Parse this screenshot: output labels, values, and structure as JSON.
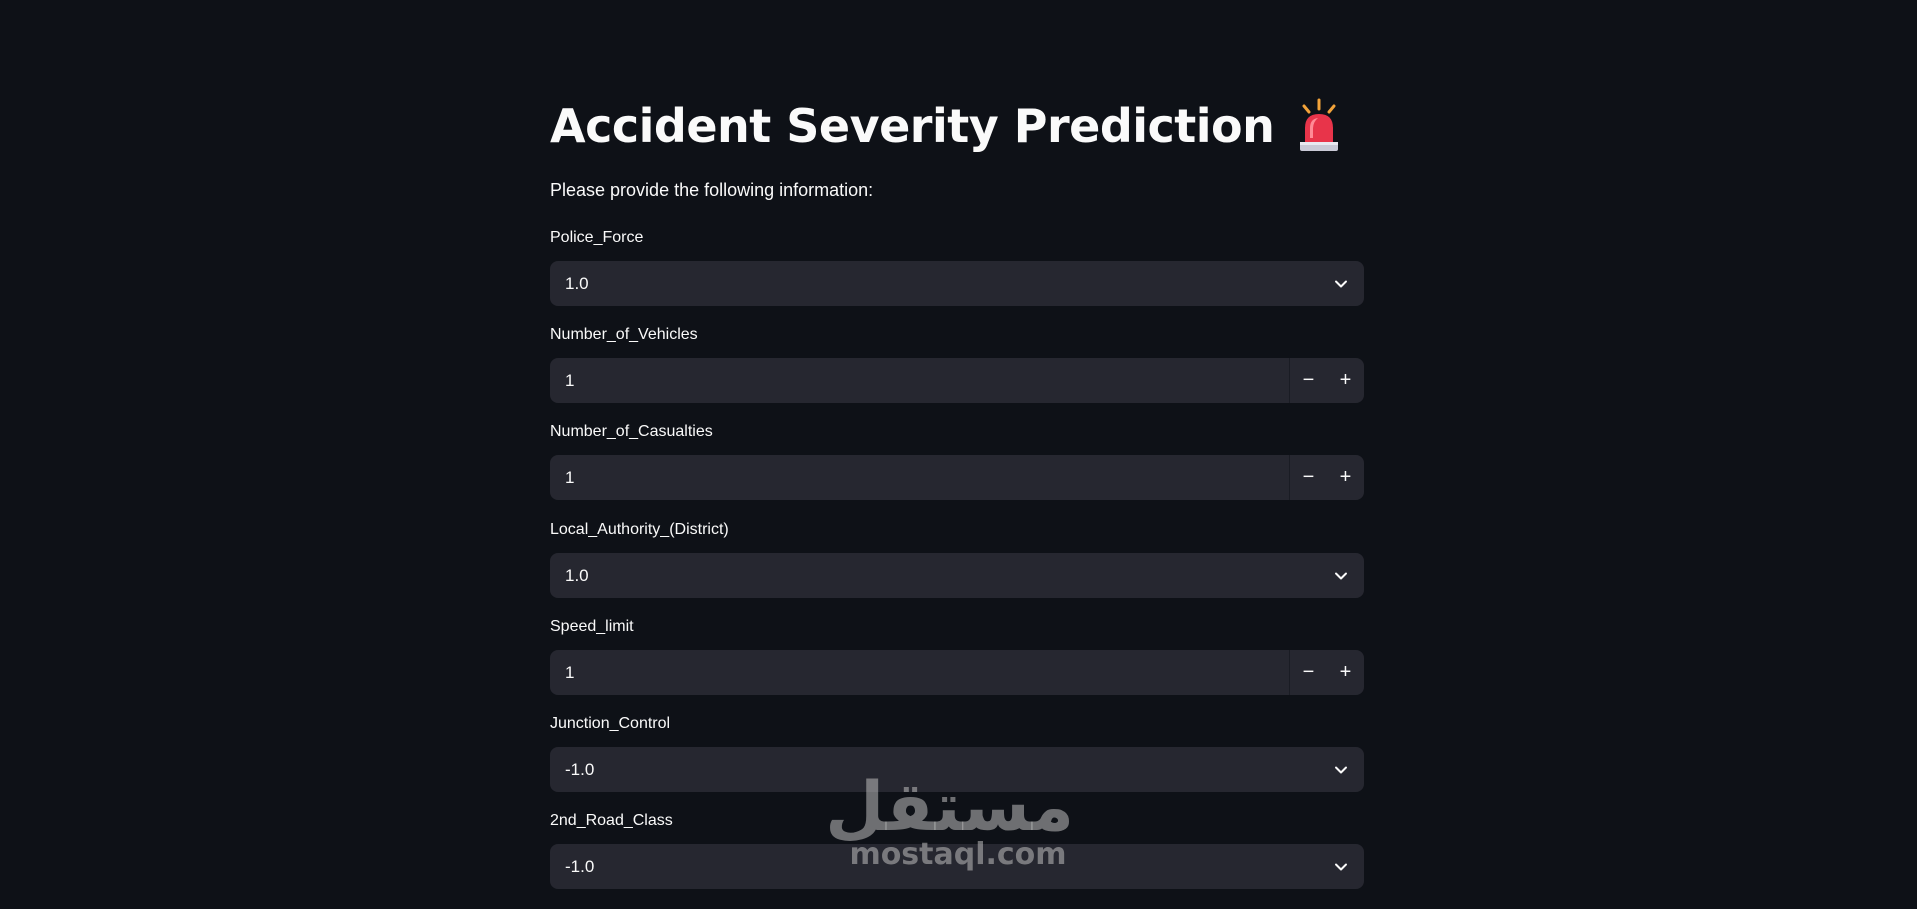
{
  "app": {
    "title": "Accident Severity Prediction",
    "title_icon": "police-siren-icon",
    "intro": "Please provide the following information:"
  },
  "fields": [
    {
      "label": "Police_Force",
      "type": "select",
      "value": "1.0",
      "icon": "chevron-down-icon"
    },
    {
      "label": "Number_of_Vehicles",
      "type": "number",
      "value": "1",
      "decrement": "−",
      "increment": "+"
    },
    {
      "label": "Number_of_Casualties",
      "type": "number",
      "value": "1",
      "decrement": "−",
      "increment": "+"
    },
    {
      "label": "Local_Authority_(District)",
      "type": "select",
      "value": "1.0",
      "icon": "chevron-down-icon"
    },
    {
      "label": "Speed_limit",
      "type": "number",
      "value": "1",
      "decrement": "−",
      "increment": "+"
    },
    {
      "label": "Junction_Control",
      "type": "select",
      "value": "-1.0",
      "icon": "chevron-down-icon"
    },
    {
      "label": "2nd_Road_Class",
      "type": "select",
      "value": "-1.0",
      "icon": "chevron-down-icon"
    }
  ],
  "watermark": {
    "arabic": "مستقل",
    "latin": "mostaql.com"
  },
  "colors": {
    "background": "#0e1117",
    "input_background": "#262730",
    "text": "#fafafa"
  }
}
